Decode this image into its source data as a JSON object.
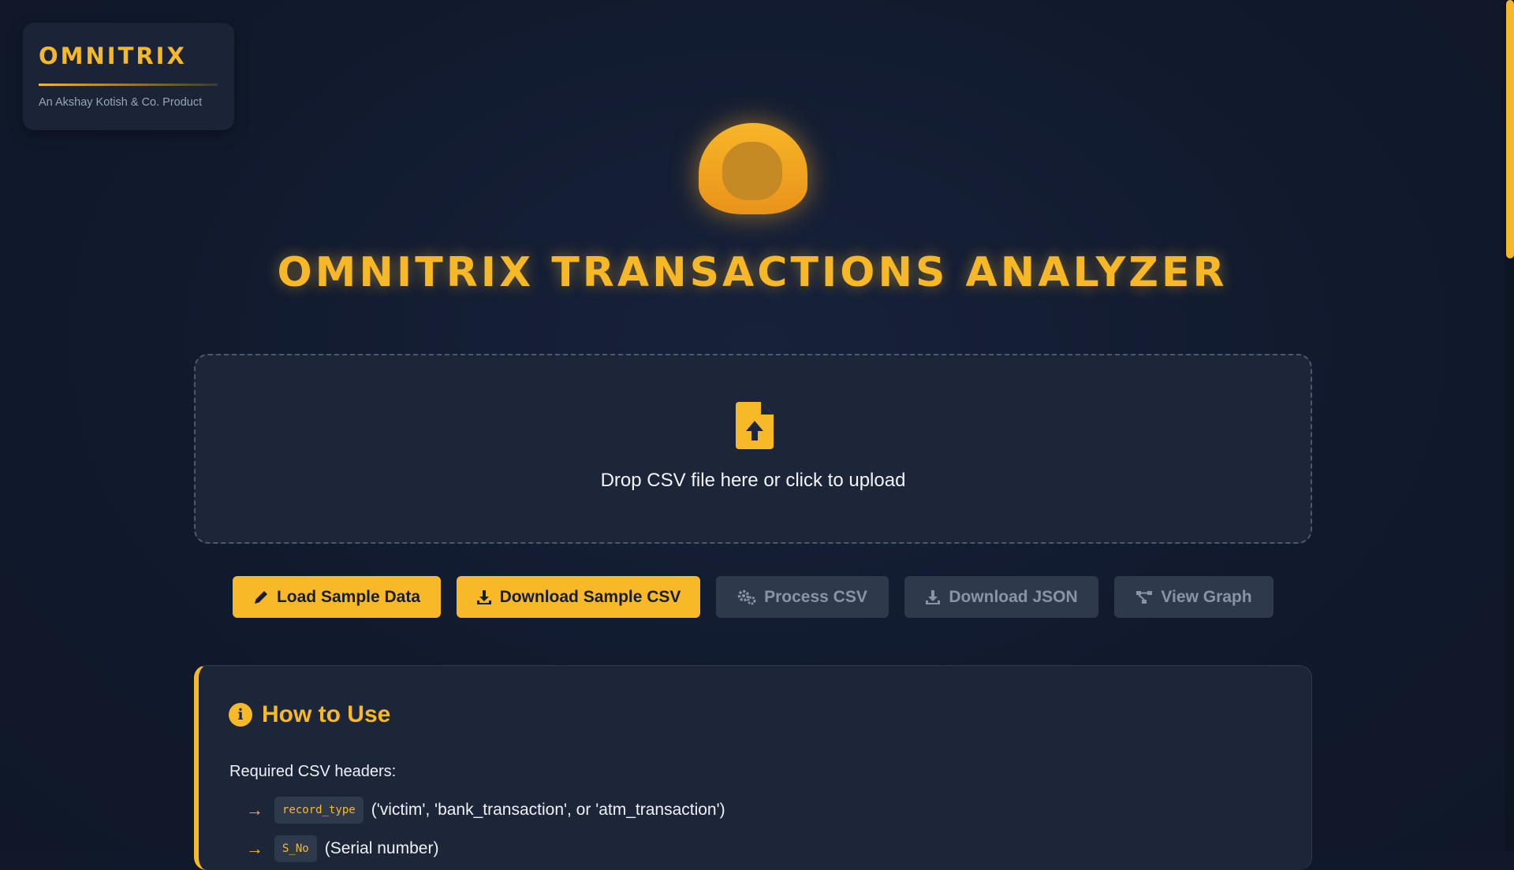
{
  "brand": {
    "title": "OMNITRIX",
    "subtitle": "An Akshay Kotish & Co. Product"
  },
  "app": {
    "title": "OMNITRIX TRANSACTIONS ANALYZER",
    "accent_color": "#f8b928"
  },
  "upload": {
    "icon": "file-upload-icon",
    "prompt": "Drop CSV file here or click to upload"
  },
  "buttons": {
    "load_sample": {
      "label": "Load Sample Data",
      "icon": "pen-icon",
      "enabled": true
    },
    "download_sample": {
      "label": "Download Sample CSV",
      "icon": "download-icon",
      "enabled": true
    },
    "process_csv": {
      "label": "Process CSV",
      "icon": "gears-icon",
      "enabled": false
    },
    "download_json": {
      "label": "Download JSON",
      "icon": "download-icon",
      "enabled": false
    },
    "view_graph": {
      "label": "View Graph",
      "icon": "graph-icon",
      "enabled": false
    }
  },
  "howto": {
    "title": "How to Use",
    "icon": "info-icon",
    "headers_label": "Required CSV headers:",
    "headers": [
      {
        "arrow": "→",
        "name": "record_type",
        "desc": "('victim', 'bank_transaction', or 'atm_transaction')"
      },
      {
        "arrow": "→",
        "name": "S_No",
        "desc": "(Serial number)"
      }
    ]
  }
}
